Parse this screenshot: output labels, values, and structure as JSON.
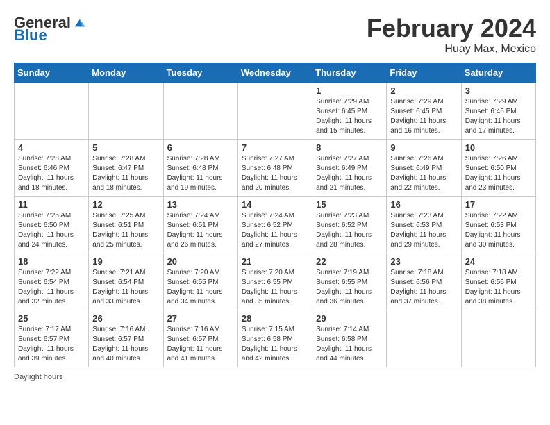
{
  "logo": {
    "general": "General",
    "blue": "Blue"
  },
  "title": "February 2024",
  "location": "Huay Max, Mexico",
  "days_of_week": [
    "Sunday",
    "Monday",
    "Tuesday",
    "Wednesday",
    "Thursday",
    "Friday",
    "Saturday"
  ],
  "weeks": [
    [
      {
        "day": "",
        "info": ""
      },
      {
        "day": "",
        "info": ""
      },
      {
        "day": "",
        "info": ""
      },
      {
        "day": "",
        "info": ""
      },
      {
        "day": "1",
        "info": "Sunrise: 7:29 AM\nSunset: 6:45 PM\nDaylight: 11 hours and 15 minutes."
      },
      {
        "day": "2",
        "info": "Sunrise: 7:29 AM\nSunset: 6:45 PM\nDaylight: 11 hours and 16 minutes."
      },
      {
        "day": "3",
        "info": "Sunrise: 7:29 AM\nSunset: 6:46 PM\nDaylight: 11 hours and 17 minutes."
      }
    ],
    [
      {
        "day": "4",
        "info": "Sunrise: 7:28 AM\nSunset: 6:46 PM\nDaylight: 11 hours and 18 minutes."
      },
      {
        "day": "5",
        "info": "Sunrise: 7:28 AM\nSunset: 6:47 PM\nDaylight: 11 hours and 18 minutes."
      },
      {
        "day": "6",
        "info": "Sunrise: 7:28 AM\nSunset: 6:48 PM\nDaylight: 11 hours and 19 minutes."
      },
      {
        "day": "7",
        "info": "Sunrise: 7:27 AM\nSunset: 6:48 PM\nDaylight: 11 hours and 20 minutes."
      },
      {
        "day": "8",
        "info": "Sunrise: 7:27 AM\nSunset: 6:49 PM\nDaylight: 11 hours and 21 minutes."
      },
      {
        "day": "9",
        "info": "Sunrise: 7:26 AM\nSunset: 6:49 PM\nDaylight: 11 hours and 22 minutes."
      },
      {
        "day": "10",
        "info": "Sunrise: 7:26 AM\nSunset: 6:50 PM\nDaylight: 11 hours and 23 minutes."
      }
    ],
    [
      {
        "day": "11",
        "info": "Sunrise: 7:25 AM\nSunset: 6:50 PM\nDaylight: 11 hours and 24 minutes."
      },
      {
        "day": "12",
        "info": "Sunrise: 7:25 AM\nSunset: 6:51 PM\nDaylight: 11 hours and 25 minutes."
      },
      {
        "day": "13",
        "info": "Sunrise: 7:24 AM\nSunset: 6:51 PM\nDaylight: 11 hours and 26 minutes."
      },
      {
        "day": "14",
        "info": "Sunrise: 7:24 AM\nSunset: 6:52 PM\nDaylight: 11 hours and 27 minutes."
      },
      {
        "day": "15",
        "info": "Sunrise: 7:23 AM\nSunset: 6:52 PM\nDaylight: 11 hours and 28 minutes."
      },
      {
        "day": "16",
        "info": "Sunrise: 7:23 AM\nSunset: 6:53 PM\nDaylight: 11 hours and 29 minutes."
      },
      {
        "day": "17",
        "info": "Sunrise: 7:22 AM\nSunset: 6:53 PM\nDaylight: 11 hours and 30 minutes."
      }
    ],
    [
      {
        "day": "18",
        "info": "Sunrise: 7:22 AM\nSunset: 6:54 PM\nDaylight: 11 hours and 32 minutes."
      },
      {
        "day": "19",
        "info": "Sunrise: 7:21 AM\nSunset: 6:54 PM\nDaylight: 11 hours and 33 minutes."
      },
      {
        "day": "20",
        "info": "Sunrise: 7:20 AM\nSunset: 6:55 PM\nDaylight: 11 hours and 34 minutes."
      },
      {
        "day": "21",
        "info": "Sunrise: 7:20 AM\nSunset: 6:55 PM\nDaylight: 11 hours and 35 minutes."
      },
      {
        "day": "22",
        "info": "Sunrise: 7:19 AM\nSunset: 6:55 PM\nDaylight: 11 hours and 36 minutes."
      },
      {
        "day": "23",
        "info": "Sunrise: 7:18 AM\nSunset: 6:56 PM\nDaylight: 11 hours and 37 minutes."
      },
      {
        "day": "24",
        "info": "Sunrise: 7:18 AM\nSunset: 6:56 PM\nDaylight: 11 hours and 38 minutes."
      }
    ],
    [
      {
        "day": "25",
        "info": "Sunrise: 7:17 AM\nSunset: 6:57 PM\nDaylight: 11 hours and 39 minutes."
      },
      {
        "day": "26",
        "info": "Sunrise: 7:16 AM\nSunset: 6:57 PM\nDaylight: 11 hours and 40 minutes."
      },
      {
        "day": "27",
        "info": "Sunrise: 7:16 AM\nSunset: 6:57 PM\nDaylight: 11 hours and 41 minutes."
      },
      {
        "day": "28",
        "info": "Sunrise: 7:15 AM\nSunset: 6:58 PM\nDaylight: 11 hours and 42 minutes."
      },
      {
        "day": "29",
        "info": "Sunrise: 7:14 AM\nSunset: 6:58 PM\nDaylight: 11 hours and 44 minutes."
      },
      {
        "day": "",
        "info": ""
      },
      {
        "day": "",
        "info": ""
      }
    ]
  ],
  "footer": {
    "daylight_hours": "Daylight hours"
  }
}
